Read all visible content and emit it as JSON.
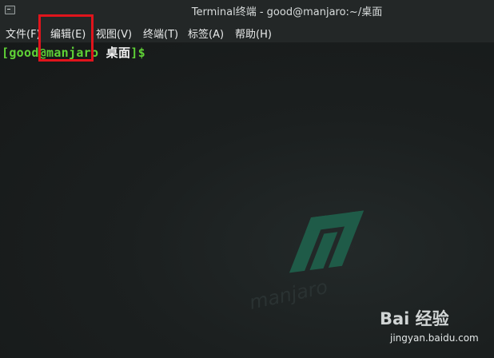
{
  "window": {
    "title": "Terminal终端 - good@manjaro:~/桌面",
    "icon": "terminal-icon"
  },
  "menu": {
    "items": [
      "文件(F)",
      "编辑(E)",
      "视图(V)",
      "终端(T)",
      "标签(A)",
      "帮助(H)"
    ],
    "highlighted": "编辑(E)"
  },
  "terminal": {
    "prompt": {
      "open_bracket": "[",
      "user_host": "good@manjaro",
      "cwd": "桌面",
      "close": "]$"
    },
    "wallpaper_text": "manjaro"
  },
  "watermark": {
    "brand": "Bai 经验",
    "url": "jingyan.baidu.com"
  },
  "colors": {
    "prompt_green": "#5fd236",
    "highlight_red": "#e0141c",
    "logo_green": "#1f5b48"
  }
}
